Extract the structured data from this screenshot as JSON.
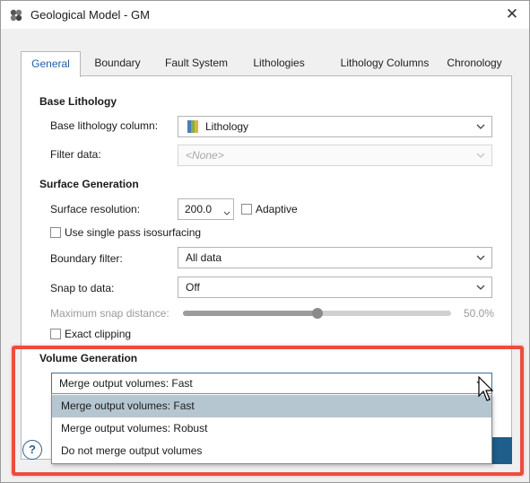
{
  "window": {
    "title": "Geological Model - GM",
    "close_glyph": "✕"
  },
  "tabs": [
    {
      "label": "General"
    },
    {
      "label": "Boundary"
    },
    {
      "label": "Fault System"
    },
    {
      "label": "Lithologies"
    },
    {
      "label": "Lithology Columns"
    },
    {
      "label": "Chronology"
    }
  ],
  "base_lithology": {
    "section_title": "Base Lithology",
    "column_label": "Base lithology column:",
    "column_value": "Lithology",
    "filter_label": "Filter data:",
    "filter_placeholder": "<None>"
  },
  "surface_generation": {
    "section_title": "Surface Generation",
    "resolution_label": "Surface resolution:",
    "resolution_value": "200.0",
    "adaptive_label": "Adaptive",
    "single_pass_label": "Use single pass isosurfacing",
    "boundary_filter_label": "Boundary filter:",
    "boundary_filter_value": "All data",
    "snap_label": "Snap to data:",
    "snap_value": "Off",
    "max_snap_label": "Maximum snap distance:",
    "max_snap_value": "50.0%",
    "max_snap_fraction": 0.5,
    "exact_clipping_label": "Exact clipping"
  },
  "volume_generation": {
    "section_title": "Volume Generation",
    "selected_value": "Merge output volumes: Fast",
    "options": [
      {
        "label": "Merge output volumes: Fast"
      },
      {
        "label": "Merge output volumes: Robust"
      },
      {
        "label": "Do not merge output volumes"
      }
    ]
  },
  "footer": {
    "help_glyph": "?"
  },
  "colors": {
    "accent": "#1f5fa8",
    "highlight_box": "#ee4c3c",
    "selected_option": "#b6c6d0"
  },
  "icons": [
    "app-icon",
    "close-icon",
    "lithology-icon",
    "chevron-down-icon",
    "help-icon",
    "mouse-cursor-icon"
  ]
}
